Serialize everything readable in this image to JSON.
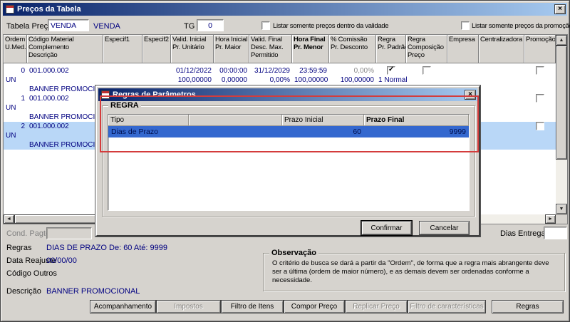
{
  "glyphs": {
    "close": "×",
    "check": "✓",
    "up": "▲",
    "down": "▼",
    "left": "◄",
    "right": "►"
  },
  "window": {
    "title": "Preços da Tabela"
  },
  "toolbar": {
    "tabela_preco": {
      "label": "Tabela Preço",
      "value": "VENDA",
      "description": "VENDA"
    },
    "tg": {
      "label": "TG",
      "value": "0"
    },
    "chk_validade": "Listar somente preços dentro da validade",
    "chk_promocao": "Listar somente preços da promoção"
  },
  "grid": {
    "columns": [
      {
        "lines": [
          "Ordem",
          "U.Med."
        ]
      },
      {
        "lines": [
          "Código Material",
          "Complemento",
          "Descrição"
        ]
      },
      {
        "lines": [
          "Especif1"
        ]
      },
      {
        "lines": [
          "Especif2"
        ]
      },
      {
        "lines": [
          "Valid. Inicial",
          "Pr. Unitário"
        ]
      },
      {
        "lines": [
          "Hora Inicial",
          "Pr. Maior"
        ]
      },
      {
        "lines": [
          "Valid. Final",
          "Desc. Max.",
          "Permitido"
        ]
      },
      {
        "lines": [
          "Hora Final",
          "Pr. Menor"
        ],
        "bold": true
      },
      {
        "lines": [
          "% Comissão",
          "Pr. Desconto"
        ]
      },
      {
        "lines": [
          "Regra",
          "Pr. Padrão"
        ]
      },
      {
        "lines": [
          "Regra",
          "Composição",
          "Preço"
        ]
      },
      {
        "lines": [
          "Empresa"
        ]
      },
      {
        "lines": [
          "Centralizadora"
        ]
      },
      {
        "lines": [
          "Promoção"
        ]
      }
    ],
    "rows": [
      {
        "ordem": "0",
        "codigo": "001.000.002",
        "umed": "UN",
        "descricao": "BANNER PROMOCIONAL",
        "valid_inicial": "01/12/2022",
        "hora_inicial": "00:00:00",
        "valid_final": "31/12/2029",
        "hora_final": "23:59:59",
        "comissao": "0,00%",
        "pr_unitario": "100,00000",
        "pr_maior": "0,00000",
        "desc_max": "0,00%",
        "pr_menor": "100,00000",
        "pr_desconto": "100,00000",
        "regra": "1 Normal",
        "regra_padrao": true,
        "regra_composicao": false,
        "promocao": false,
        "selected": false
      },
      {
        "ordem": "1",
        "codigo": "001.000.002",
        "umed": "UN",
        "descricao": "BANNER PROMOCIONAL",
        "promocao": false,
        "selected": false
      },
      {
        "ordem": "2",
        "codigo": "001.000.002",
        "umed": "UN",
        "descricao": "BANNER PROMOCIONAL",
        "promocao": false,
        "selected": true
      }
    ]
  },
  "dialog": {
    "title": "Regras de Parâmetros",
    "group_title": "REGRA",
    "table": {
      "headers": [
        "Tipo",
        "",
        "Prazo Inicial",
        "Prazo Final"
      ],
      "row": {
        "tipo": "Dias de Prazo",
        "prazo_inicial": "60",
        "prazo_final": "9999"
      }
    },
    "buttons": {
      "confirm": "Confirmar",
      "cancel": "Cancelar"
    }
  },
  "footer": {
    "cond_pagto_label": "Cond. Pagto.",
    "dias_entrega_label": "Dias Entrega",
    "regras_label": "Regras",
    "regras_value": "DIAS DE PRAZO De: 60 Até: 9999",
    "data_reajuste_label": "Data Reajuste",
    "data_reajuste_value": "00/00/00",
    "codigo_outros_label": "Código Outros",
    "descricao_label": "Descrição",
    "descricao_value": "BANNER PROMOCIONAL",
    "observacao": {
      "title": "Observação",
      "text": "O critério de busca se dará a partir da \"Ordem\", de forma que a regra mais abrangente deve ser a última (ordem de maior número), e as demais devem ser ordenadas conforme a necessidade."
    }
  },
  "actions": [
    {
      "label": "Acompanhamento",
      "enabled": true
    },
    {
      "label": "Impostos",
      "enabled": false
    },
    {
      "label": "Filtro de Itens",
      "enabled": true
    },
    {
      "label": "Compor Preço",
      "enabled": true
    },
    {
      "label": "Replicar Preço",
      "enabled": false
    },
    {
      "label": "Filtro de características",
      "enabled": false
    },
    {
      "label": "Regras",
      "enabled": true
    }
  ]
}
